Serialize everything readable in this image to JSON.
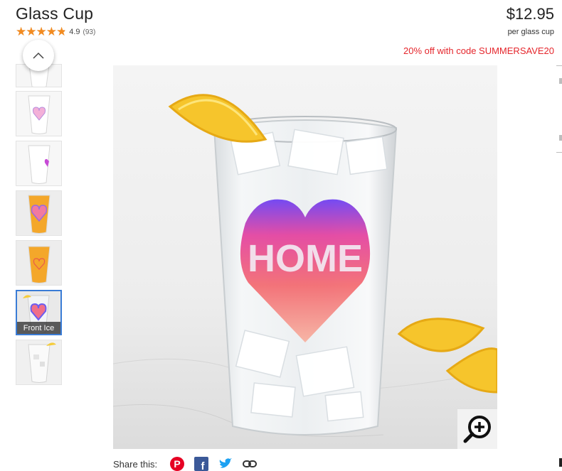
{
  "product": {
    "title": "Glass Cup",
    "rating": 4.9,
    "rating_text": "4.9",
    "review_count": "(93)",
    "price": "$12.95",
    "per_unit": "per glass cup",
    "promo": "20% off with code SUMMERSAVE20"
  },
  "gallery": {
    "thumbnails": [
      {
        "id": "t1"
      },
      {
        "id": "t2"
      },
      {
        "id": "t3"
      },
      {
        "id": "t4"
      },
      {
        "id": "t5"
      },
      {
        "id": "t6",
        "caption": "Front Ice"
      },
      {
        "id": "t7"
      }
    ]
  },
  "main_image": {
    "print_text": "HOME"
  },
  "share": {
    "label": "Share this:"
  },
  "colors": {
    "accent": "#3a7cd6",
    "star": "#f28b21",
    "promo": "#e5262c",
    "pinterest": "#e60023",
    "facebook": "#1877f2",
    "twitter": "#1da1f2"
  }
}
